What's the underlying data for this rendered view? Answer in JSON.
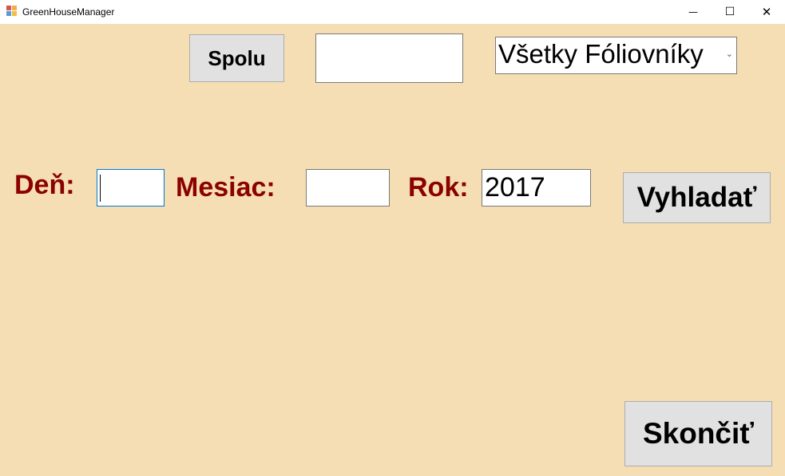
{
  "window": {
    "title": "GreenHouseManager",
    "minimize_glyph": "—",
    "maximize_glyph": "☐",
    "close_glyph": "✕"
  },
  "toolbar": {
    "spolu_label": "Spolu",
    "total_value": "",
    "greenhouse_select": {
      "selected": "Všetky Fóliovníky",
      "arrow": "⌄"
    }
  },
  "date_filter": {
    "day_label": "Deň:",
    "day_value": "",
    "month_label": "Mesiac:",
    "month_value": "",
    "year_label": "Rok:",
    "year_value": "2017",
    "search_label": "Vyhladať"
  },
  "footer": {
    "exit_label": "Skončiť"
  },
  "colors": {
    "background": "#f5deb3",
    "label": "#8b0000",
    "button": "#e1e1e1"
  }
}
